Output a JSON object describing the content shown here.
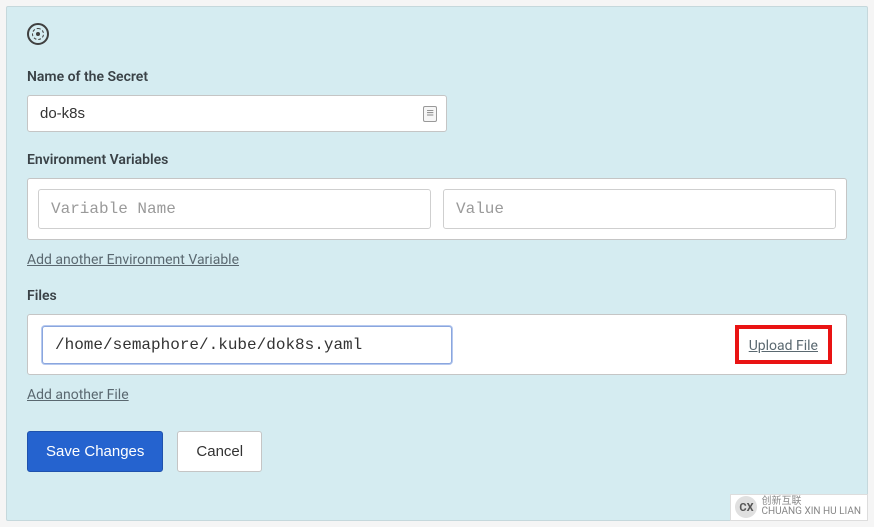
{
  "secret": {
    "name_label": "Name of the Secret",
    "name_value": "do-k8s"
  },
  "env": {
    "label": "Environment Variables",
    "name_placeholder": "Variable Name",
    "value_placeholder": "Value",
    "add_link": "Add another Environment Variable"
  },
  "files": {
    "label": "Files",
    "path_value": "/home/semaphore/.kube/dok8s.yaml",
    "upload_label": "Upload File",
    "add_link": "Add another File"
  },
  "buttons": {
    "save": "Save Changes",
    "cancel": "Cancel"
  },
  "watermark": {
    "logo": "CX",
    "line1": "创新互联",
    "line2": "CHUANG XIN HU LIAN"
  }
}
